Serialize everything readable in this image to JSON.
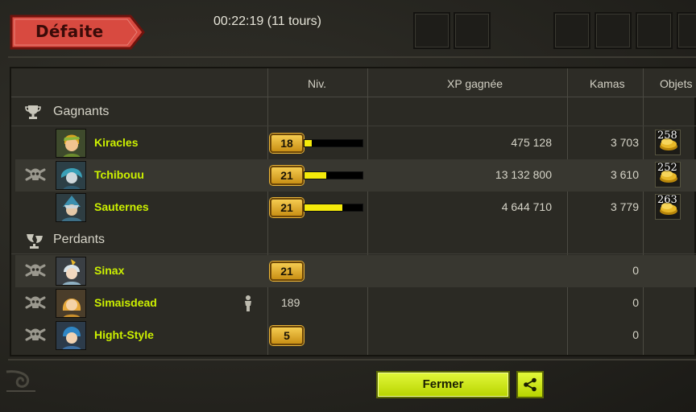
{
  "header": {
    "result_label": "Défaite",
    "duration": "00:22:19 (11 tours)"
  },
  "table": {
    "columns": [
      "Niv.",
      "XP gagnée",
      "Kamas",
      "Objets g"
    ],
    "groups": [
      {
        "label": "Gagnants",
        "icon": "trophy-icon",
        "players": [
          {
            "name": "Kiracles",
            "dead": false,
            "level": "18",
            "xp_progress": 0.12,
            "xp": "475 128",
            "kamas": "3 703",
            "loot_count": "258",
            "loot_icon": "coin-pile-icon"
          },
          {
            "name": "Tchibouu",
            "dead": true,
            "level": "21",
            "xp_progress": 0.38,
            "xp": "13 132 800",
            "kamas": "3 610",
            "loot_count": "252",
            "loot_icon": "coin-pile-icon"
          },
          {
            "name": "Sauternes",
            "dead": false,
            "level": "21",
            "xp_progress": 0.65,
            "xp": "4 644 710",
            "kamas": "3 779",
            "loot_count": "263",
            "loot_icon": "coin-pile-icon"
          }
        ]
      },
      {
        "label": "Perdants",
        "icon": "broken-trophy-icon",
        "players": [
          {
            "name": "Sinax",
            "dead": true,
            "level": "21",
            "xp": "",
            "kamas": "0"
          },
          {
            "name": "Simaisdead",
            "dead": true,
            "level": "189",
            "companion": true,
            "xp": "",
            "kamas": "0"
          },
          {
            "name": "Hight-Style",
            "dead": true,
            "level": "5",
            "xp": "",
            "kamas": "0"
          }
        ]
      }
    ]
  },
  "footer": {
    "close_label": "Fermer",
    "share_icon": "share-icon"
  },
  "colors": {
    "player_name": "#ccf000",
    "xp_fill": "#f5ea0a",
    "button": "#d2ec1c",
    "banner": "#d9443a"
  }
}
